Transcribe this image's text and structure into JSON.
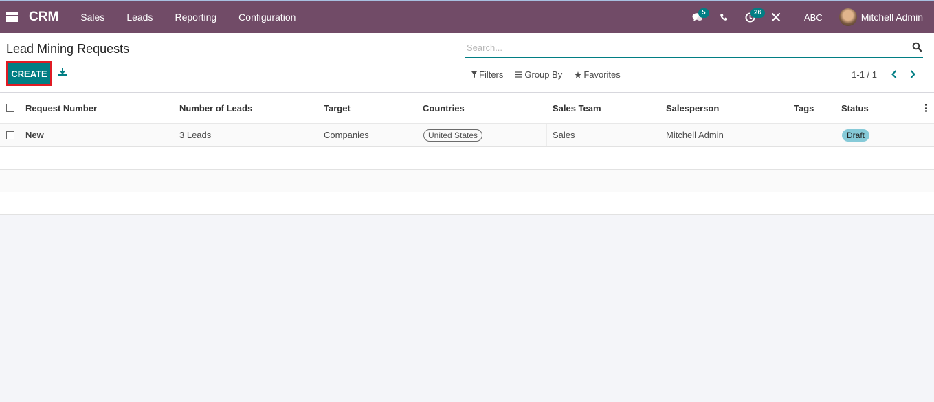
{
  "navbar": {
    "brand": "CRM",
    "menu": [
      "Sales",
      "Leads",
      "Reporting",
      "Configuration"
    ],
    "messages_count": "5",
    "activities_count": "26",
    "company": "ABC",
    "user_name": "Mitchell Admin",
    "icons": [
      "apps-grid-icon",
      "chat-icon",
      "phone-icon",
      "clock-icon",
      "tools-icon"
    ]
  },
  "control_panel": {
    "title": "Lead Mining Requests",
    "create_label": "CREATE",
    "search_placeholder": "Search...",
    "filters_label": "Filters",
    "group_by_label": "Group By",
    "favorites_label": "Favorites",
    "pager": "1-1 / 1"
  },
  "colors": {
    "navbar": "#714b67",
    "primary": "#017e84",
    "highlight_border": "#e01b24",
    "draft_badge": "#86cad8"
  },
  "table": {
    "columns": [
      "Request Number",
      "Number of Leads",
      "Target",
      "Countries",
      "Sales Team",
      "Salesperson",
      "Tags",
      "Status"
    ],
    "rows": [
      {
        "request_number": "New",
        "number_of_leads": "3 Leads",
        "target": "Companies",
        "countries": "United States",
        "sales_team": "Sales",
        "salesperson": "Mitchell Admin",
        "tags": "",
        "status": "Draft"
      }
    ]
  }
}
